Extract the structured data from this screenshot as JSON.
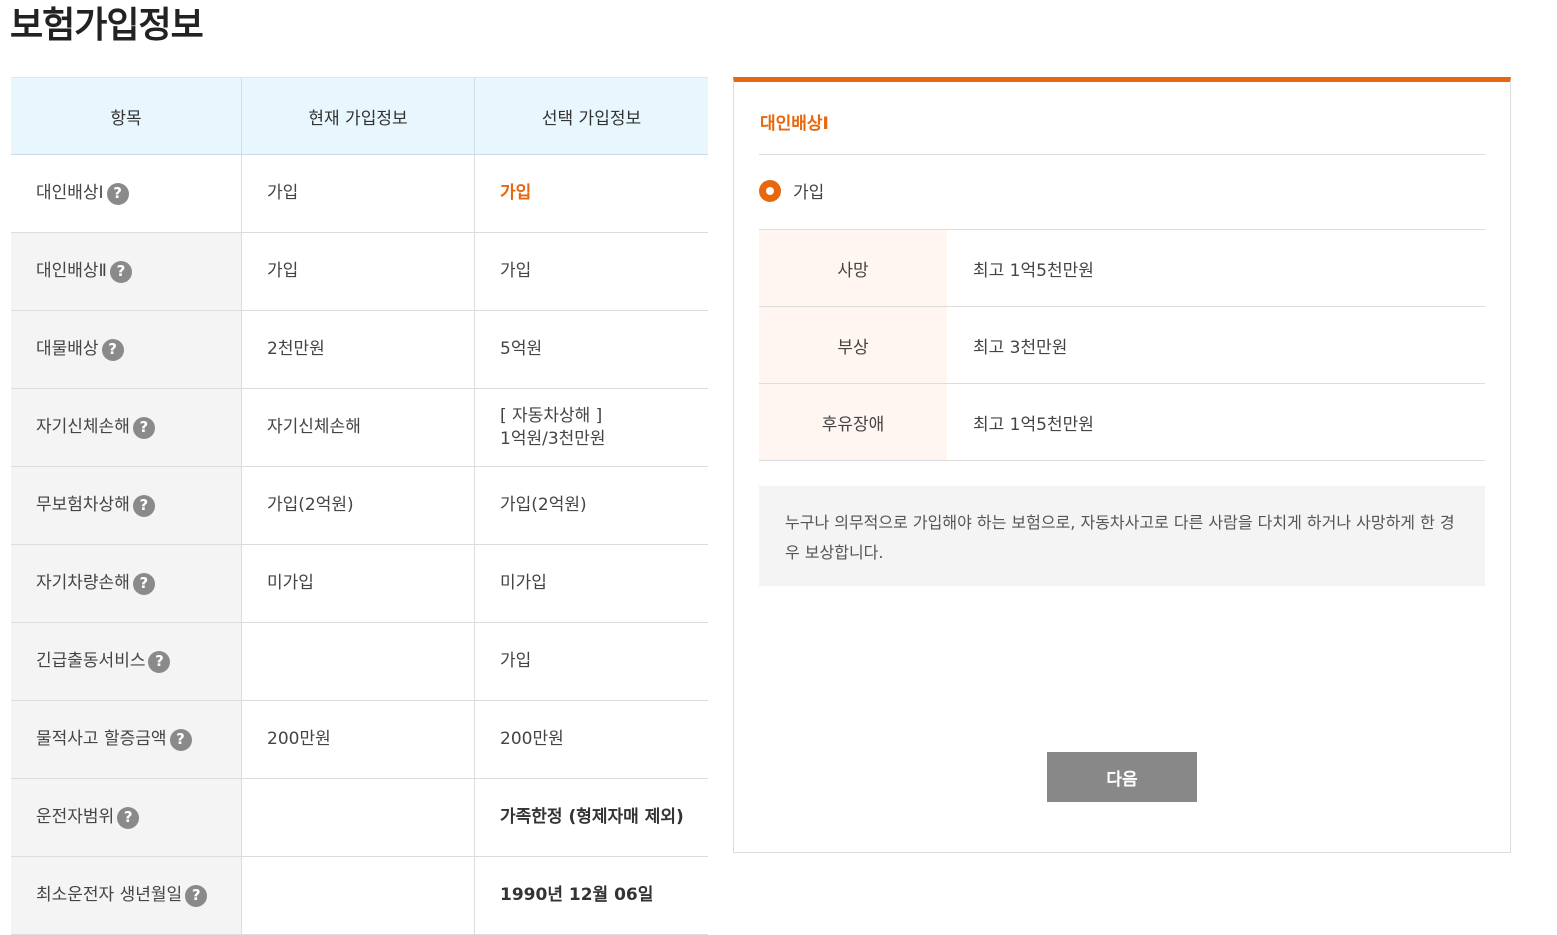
{
  "page": {
    "title": "보험가입정보"
  },
  "table": {
    "headers": [
      "항목",
      "현재 가입정보",
      "선택 가입정보"
    ],
    "rows": [
      {
        "label": "대인배상Ⅰ",
        "current": "가입",
        "selected": "가입",
        "style": "accent"
      },
      {
        "label": "대인배상Ⅱ",
        "current": "가입",
        "selected": "가입",
        "style": "normal"
      },
      {
        "label": "대물배상",
        "current": "2천만원",
        "selected": "5억원",
        "style": "normal"
      },
      {
        "label": "자기신체손해",
        "current": "자기신체손해",
        "selected": "[   자동차상해   ]\n1억원/3천만원",
        "style": "normal"
      },
      {
        "label": "무보험차상해",
        "current": "가입(2억원)",
        "selected": "가입(2억원)",
        "style": "normal"
      },
      {
        "label": "자기차량손해",
        "current": "미가입",
        "selected": "미가입",
        "style": "normal"
      },
      {
        "label": "긴급출동서비스",
        "current": "",
        "selected": "가입",
        "style": "normal"
      },
      {
        "label": "물적사고 할증금액",
        "current": "200만원",
        "selected": "200만원",
        "style": "normal"
      },
      {
        "label": "운전자범위",
        "current": "",
        "selected": "가족한정 (형제자매 제외)",
        "style": "bold"
      },
      {
        "label": "최소운전자 생년월일",
        "current": "",
        "selected": "1990년 12월 06일",
        "style": "bold"
      }
    ]
  },
  "help_icon": {
    "name": "question-icon",
    "glyph": "?"
  },
  "detail": {
    "title": "대인배상Ⅰ",
    "option_label": "가입",
    "coverage": [
      {
        "key": "사망",
        "value": "최고 1억5천만원"
      },
      {
        "key": "부상",
        "value": "최고 3천만원"
      },
      {
        "key": "후유장애",
        "value": "최고 1억5천만원"
      }
    ],
    "description": "누구나 의무적으로 가입해야 하는 보험으로, 자동차사고로 다른 사람을 다치게 하거나 사망하게 한 경우 보상합니다.",
    "next_label": "다음"
  },
  "colors": {
    "accent": "#e8670c",
    "header_bg": "#e8f6fd",
    "button_bg": "#888888"
  }
}
